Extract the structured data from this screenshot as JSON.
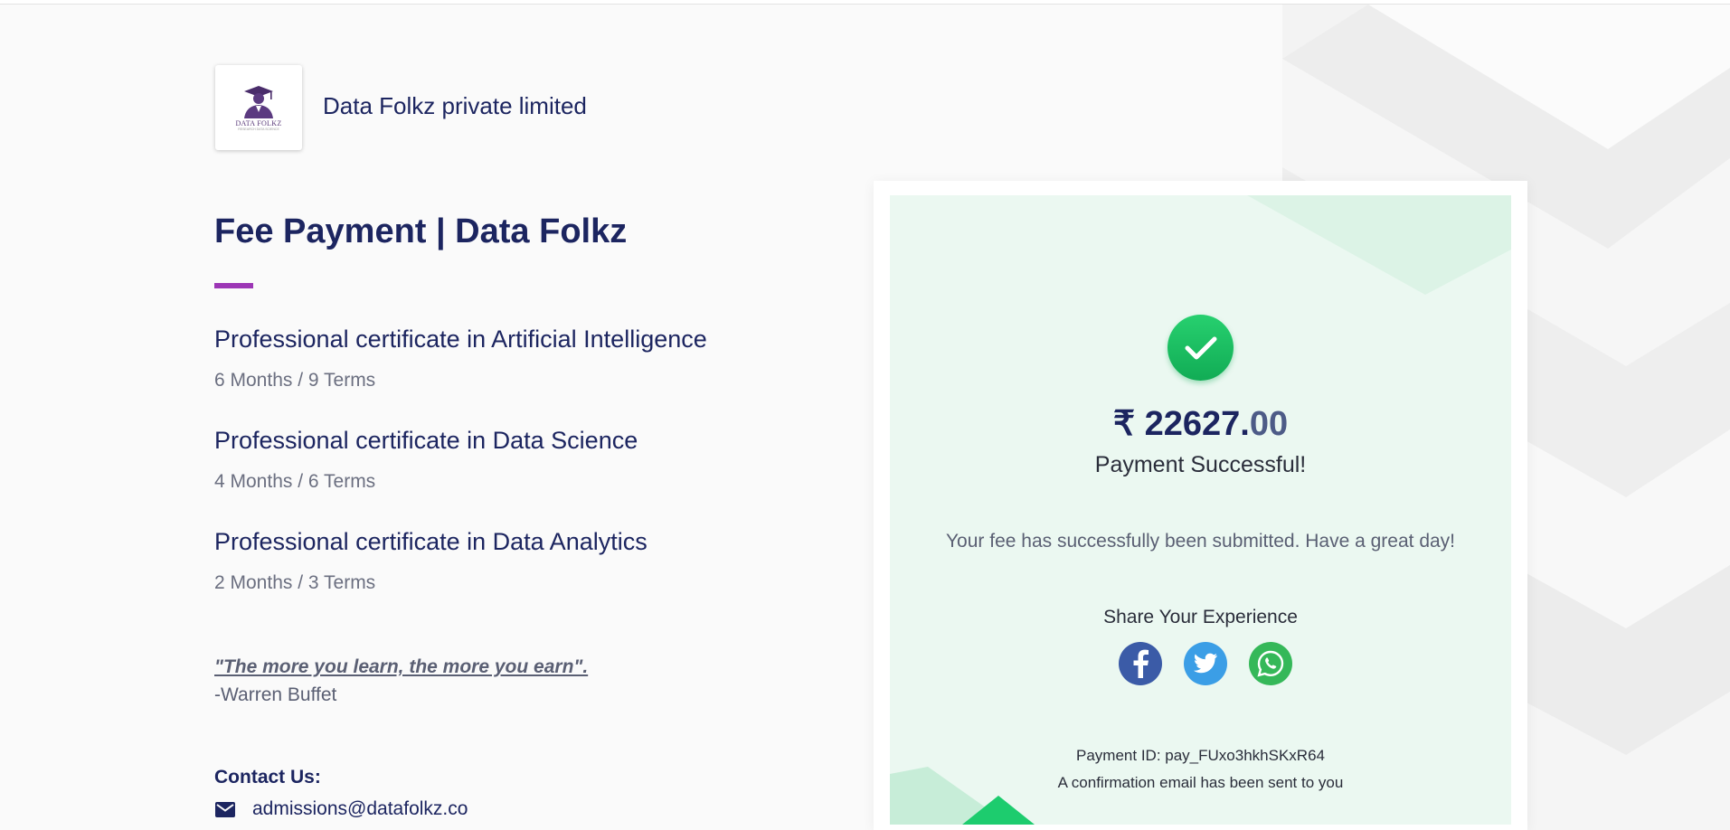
{
  "organization": {
    "name": "Data Folkz private limited",
    "logo_text": "DATA FOLKZ",
    "logo_subtext": "RESEARCH DATA SCIENCE"
  },
  "page": {
    "title": "Fee Payment | Data Folkz"
  },
  "courses": [
    {
      "title": "Professional certificate in Artificial Intelligence",
      "duration": "6 Months / 9 Terms"
    },
    {
      "title": "Professional certificate in Data Science",
      "duration": "4 Months / 6 Terms"
    },
    {
      "title": "Professional certificate in Data Analytics",
      "duration": "2 Months / 3 Terms"
    }
  ],
  "quote": {
    "text": "\"The more you learn, the more you earn\".",
    "author": "-Warren Buffet"
  },
  "contact": {
    "label": "Contact Us:",
    "email": "admissions@datafolkz.co"
  },
  "payment": {
    "amount_main": "₹ 22627.",
    "amount_decimal": "00",
    "status": "Payment Successful!",
    "message": "Your fee has successfully been submitted. Have a great day!",
    "share_label": "Share Your Experience",
    "payment_id": "Payment ID: pay_FUxo3hkhSKxR64",
    "confirmation": "A confirmation email has been sent to you"
  },
  "colors": {
    "accent": "#9c36b5",
    "primary_text": "#1c2560",
    "success": "#18b85e",
    "card_bg": "#ebf8f1",
    "facebook": "#3b5ba7",
    "twitter": "#3b9ee6",
    "whatsapp": "#35b859"
  },
  "icons": [
    "graduate-logo-icon",
    "mail-icon",
    "check-icon",
    "facebook-icon",
    "twitter-icon",
    "whatsapp-icon"
  ]
}
